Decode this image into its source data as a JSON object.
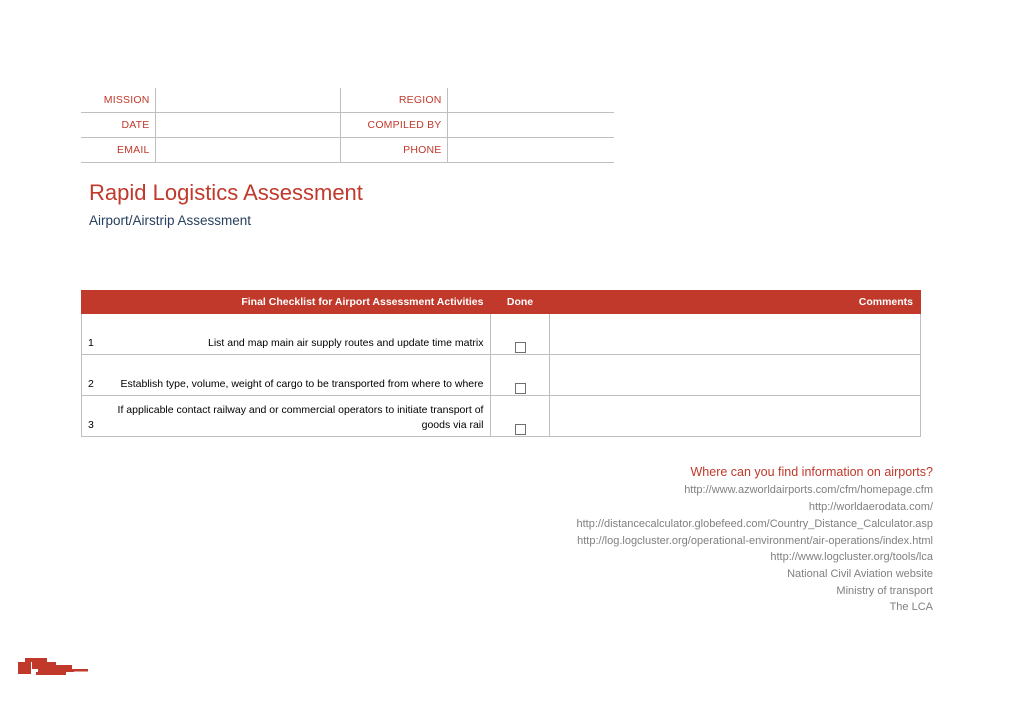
{
  "colors": {
    "brand_red": "#C0392B",
    "label_red": "#C0392B",
    "subtitle_blue": "#27405E",
    "link_gray": "#808080",
    "border_gray": "#BFBFBF"
  },
  "meta_table": {
    "rows": [
      {
        "label_left": "MISSION",
        "value_left": "",
        "label_right": "REGION",
        "value_right": ""
      },
      {
        "label_left": "DATE",
        "value_left": "",
        "label_right": "COMPILED BY",
        "value_right": ""
      },
      {
        "label_left": "EMAIL",
        "value_left": "",
        "label_right": "PHONE",
        "value_right": ""
      }
    ]
  },
  "document": {
    "title": "Rapid Logistics Assessment",
    "subtitle": "Airport/Airstrip Assessment"
  },
  "checklist": {
    "headers": {
      "activity": "Final Checklist for Airport Assessment Activities",
      "done": "Done",
      "comments": "Comments"
    },
    "rows": [
      {
        "num": "1",
        "activity": "List and map main air supply routes and update time matrix",
        "done": false,
        "comments": ""
      },
      {
        "num": "2",
        "activity": "Establish type, volume, weight of cargo to be transported from where to where",
        "done": false,
        "comments": ""
      },
      {
        "num": "3",
        "activity": "If applicable contact railway and or commercial operators to initiate transport of goods via rail",
        "done": false,
        "comments": ""
      }
    ]
  },
  "resources": {
    "heading": "Where can you find information on airports?",
    "links": [
      "http://www.azworldairports.com/cfm/homepage.cfm",
      "http://worldaerodata.com/",
      "http://distancecalculator.globefeed.com/Country_Distance_Calculator.asp",
      "http://log.logcluster.org/operational-environment/air-operations/index.html",
      "http://www.logcluster.org/tools/lca",
      "National Civil Aviation website",
      "Ministry of transport",
      "The LCA"
    ]
  },
  "footer": {
    "logo_name": "logistics-cluster-logo"
  }
}
